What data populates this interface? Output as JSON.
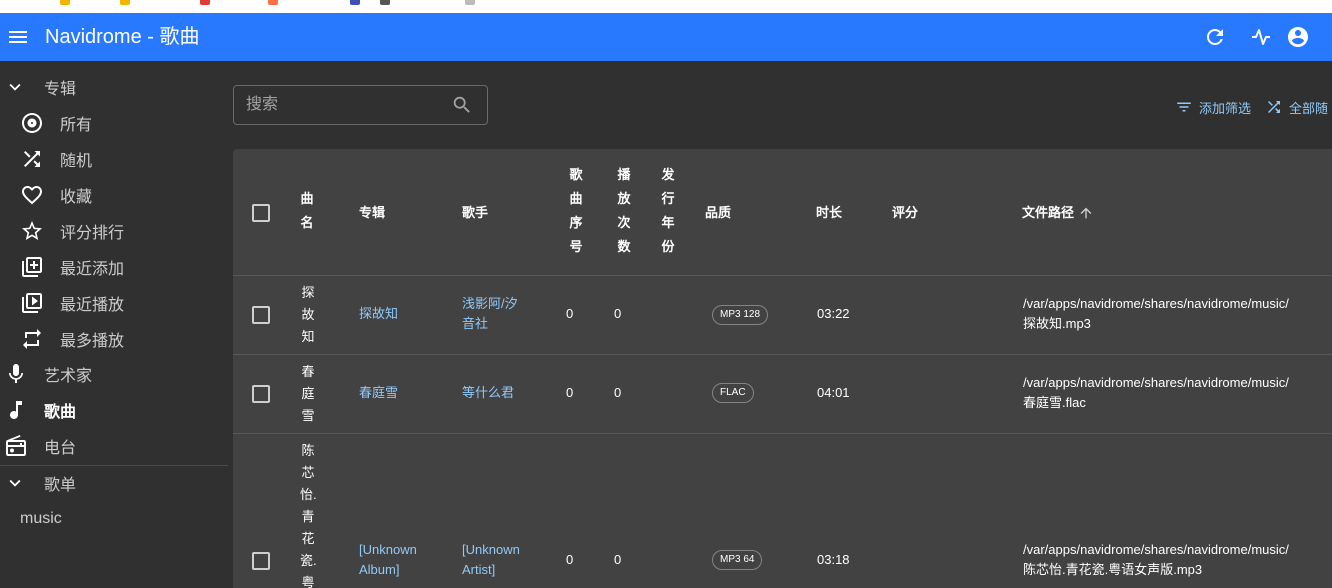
{
  "app": {
    "title": "Navidrome - 歌曲"
  },
  "sidebar": {
    "albums_header": "专辑",
    "album_items": [
      {
        "label": "所有"
      },
      {
        "label": "随机"
      },
      {
        "label": "收藏"
      },
      {
        "label": "评分排行"
      },
      {
        "label": "最近添加"
      },
      {
        "label": "最近播放"
      },
      {
        "label": "最多播放"
      }
    ],
    "artists": "艺术家",
    "songs": "歌曲",
    "radio": "电台",
    "playlists_header": "歌单",
    "playlist_items": [
      {
        "label": "music"
      }
    ]
  },
  "toolbar": {
    "search_placeholder": "搜索",
    "add_filter": "添加筛选",
    "shuffle_all": "全部随"
  },
  "table": {
    "headers": {
      "title": [
        "曲",
        "名"
      ],
      "album": "专辑",
      "artist": "歌手",
      "track": [
        "歌",
        "曲",
        "序",
        "号"
      ],
      "plays": [
        "播",
        "放",
        "次",
        "数"
      ],
      "year": [
        "发",
        "行",
        "年",
        "份"
      ],
      "quality": "品质",
      "duration": "时长",
      "rating": "评分",
      "path": "文件路径"
    },
    "rows": [
      {
        "title_chars": [
          "探",
          "故",
          "知"
        ],
        "album": [
          "探故知"
        ],
        "artist": [
          "浅影阿/汐",
          "音社"
        ],
        "track": "0",
        "plays": "0",
        "quality": "MP3 128",
        "duration": "03:22",
        "path": [
          "/var/apps/navidrome/shares/navidrome/music/",
          "探故知.mp3"
        ]
      },
      {
        "title_chars": [
          "春",
          "庭",
          "雪"
        ],
        "album": [
          "春庭雪"
        ],
        "artist": [
          "等什么君"
        ],
        "track": "0",
        "plays": "0",
        "quality": "FLAC",
        "duration": "04:01",
        "path": [
          "/var/apps/navidrome/shares/navidrome/music/",
          "春庭雪.flac"
        ]
      },
      {
        "title_chars": [
          "陈",
          "芯",
          "怡.",
          "青",
          "花",
          "瓷.",
          "粤"
        ],
        "album": [
          "[Unknown",
          "Album]"
        ],
        "artist": [
          "[Unknown",
          "Artist]"
        ],
        "track": "0",
        "plays": "0",
        "quality": "MP3 64",
        "duration": "03:18",
        "path": [
          "/var/apps/navidrome/shares/navidrome/music/",
          "陈芯怡.青花瓷.粤语女声版.mp3"
        ]
      }
    ]
  }
}
